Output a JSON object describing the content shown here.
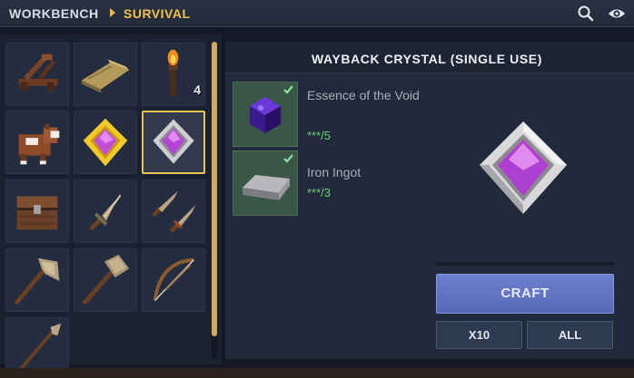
{
  "header": {
    "breadcrumb_root": "WORKBENCH",
    "breadcrumb_current": "SURVIVAL",
    "icons": [
      "search-icon",
      "eye-icon"
    ]
  },
  "grid": {
    "items": [
      {
        "name": "catapult",
        "icon": "catapult-icon"
      },
      {
        "name": "hay-bedroll",
        "icon": "bedroll-icon"
      },
      {
        "name": "torch",
        "icon": "torch-icon",
        "count": "4"
      },
      {
        "name": "saddle-creature",
        "icon": "creature-icon"
      },
      {
        "name": "gold-crystal",
        "icon": "gold-crystal-icon"
      },
      {
        "name": "wayback-crystal",
        "icon": "wayback-crystal-icon",
        "selected": true
      },
      {
        "name": "chest",
        "icon": "chest-icon"
      },
      {
        "name": "dagger",
        "icon": "dagger-icon"
      },
      {
        "name": "dual-daggers",
        "icon": "dual-daggers-icon"
      },
      {
        "name": "axe",
        "icon": "axe-icon"
      },
      {
        "name": "hammer",
        "icon": "hammer-icon"
      },
      {
        "name": "bow",
        "icon": "bow-icon"
      },
      {
        "name": "spear",
        "icon": "spear-icon"
      }
    ]
  },
  "detail": {
    "title": "WAYBACK CRYSTAL (SINGLE USE)",
    "ingredients": [
      {
        "name": "Essence of the Void",
        "qty": "***/5",
        "icon": "void-essence-icon",
        "met": true
      },
      {
        "name": "Iron Ingot",
        "qty": "***/3",
        "icon": "iron-ingot-icon",
        "met": true
      }
    ],
    "preview_icon": "wayback-crystal-icon",
    "craft_progress": 0
  },
  "buttons": {
    "craft": "CRAFT",
    "x10": "X10",
    "all": "ALL"
  },
  "colors": {
    "accent_gold": "#f0c14b",
    "craft_button": "#6274c6",
    "ingredient_met": "#6fcf7a",
    "crystal_purple": "#b044d8"
  }
}
